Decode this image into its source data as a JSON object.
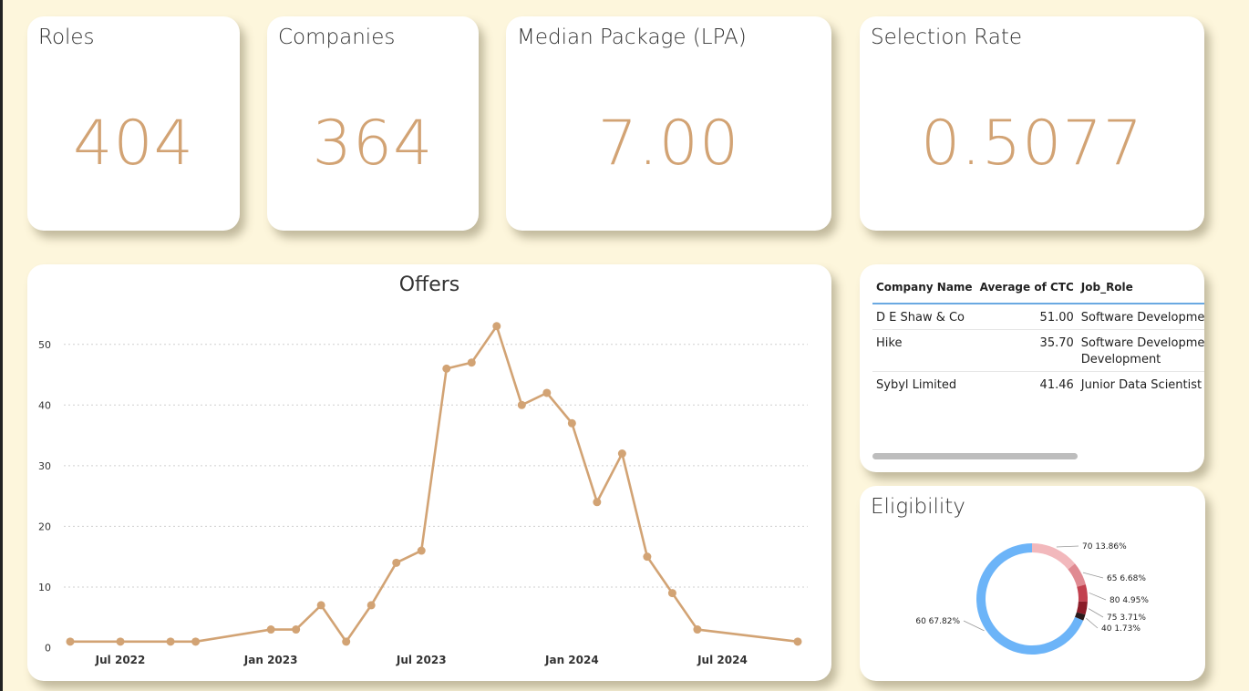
{
  "kpis": {
    "roles": {
      "title": "Roles",
      "value": "404"
    },
    "companies": {
      "title": "Companies",
      "value": "364"
    },
    "median_package": {
      "title": "Median Package (LPA)",
      "value": "7.00"
    },
    "selection_rate": {
      "title": "Selection Rate",
      "value": "0.5077"
    }
  },
  "colors": {
    "accent": "#d2a374",
    "background": "#fdf6dc",
    "table_header_line": "#6aa9e2",
    "donut": [
      "#6cb4f8",
      "#f2b8bc",
      "#e08a92",
      "#c2414f",
      "#8b1c28",
      "#2a1a1a"
    ]
  },
  "table": {
    "headers": [
      "Company Name",
      "Average of CTC",
      "Job_Role"
    ],
    "rows": [
      {
        "company": "D E Shaw & Co",
        "ctc": "51.00",
        "role": "Software Developmen"
      },
      {
        "company": "Hike",
        "ctc": "35.70",
        "role": "Software Developmen",
        "role2": "Development"
      },
      {
        "company": "Sybyl Limited",
        "ctc": "41.46",
        "role": "Junior Data Scientist"
      }
    ]
  },
  "chart_data": [
    {
      "type": "line",
      "title": "Offers",
      "xlabel": "",
      "ylabel": "",
      "x_tick_labels": [
        "Jul 2022",
        "Jan 2023",
        "Jul 2023",
        "Jan 2024",
        "Jul 2024"
      ],
      "y_ticks": [
        0,
        10,
        20,
        30,
        40,
        50
      ],
      "ylim": [
        0,
        53
      ],
      "grid": true,
      "x": [
        "2022-05",
        "2022-07",
        "2022-09",
        "2022-10",
        "2023-01",
        "2023-02",
        "2023-03",
        "2023-04",
        "2023-05",
        "2023-06",
        "2023-07",
        "2023-08",
        "2023-09",
        "2023-10",
        "2023-11",
        "2023-12",
        "2024-01",
        "2024-02",
        "2024-03",
        "2024-04",
        "2024-05",
        "2024-06",
        "2024-10"
      ],
      "values": [
        1,
        1,
        1,
        1,
        3,
        3,
        7,
        1,
        7,
        14,
        16,
        46,
        47,
        53,
        40,
        42,
        37,
        24,
        32,
        15,
        9,
        3,
        1
      ]
    },
    {
      "type": "pie",
      "title": "Eligibility",
      "donut": true,
      "categories": [
        "60",
        "70",
        "65",
        "80",
        "75",
        "40"
      ],
      "values": [
        67.82,
        13.86,
        6.68,
        4.95,
        3.71,
        1.73
      ],
      "labels": [
        "60 67.82%",
        "70 13.86%",
        "65 6.68%",
        "80 4.95%",
        "75 3.71%",
        "40 1.73%"
      ]
    }
  ]
}
